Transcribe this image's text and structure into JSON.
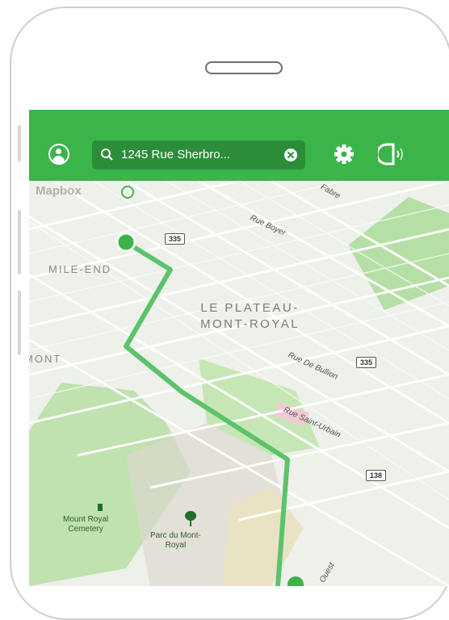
{
  "search": {
    "value": "1245 Rue Sherbro..."
  },
  "map": {
    "attribution": "Mapbox",
    "districts": [
      "MILE-END",
      "LE PLATEAU-",
      "MONT-ROYAL",
      "MONT"
    ],
    "streets": [
      "Rue Boyer",
      "Rue De Bullion",
      "Rue Saint-Urbain",
      "Fabre",
      "Ouest"
    ],
    "shields": [
      "335",
      "335",
      "138"
    ],
    "parks": [
      "Mount Royal",
      "Cemetery",
      "Parc du Mont-",
      "Royal"
    ]
  },
  "colors": {
    "brand": "#3bb54a",
    "search_bg": "#2c8d39",
    "route": "#5cc36a"
  },
  "icons": [
    "avatar-icon",
    "search-icon",
    "clear-icon",
    "gear-icon",
    "voice-icon",
    "info-icon"
  ]
}
